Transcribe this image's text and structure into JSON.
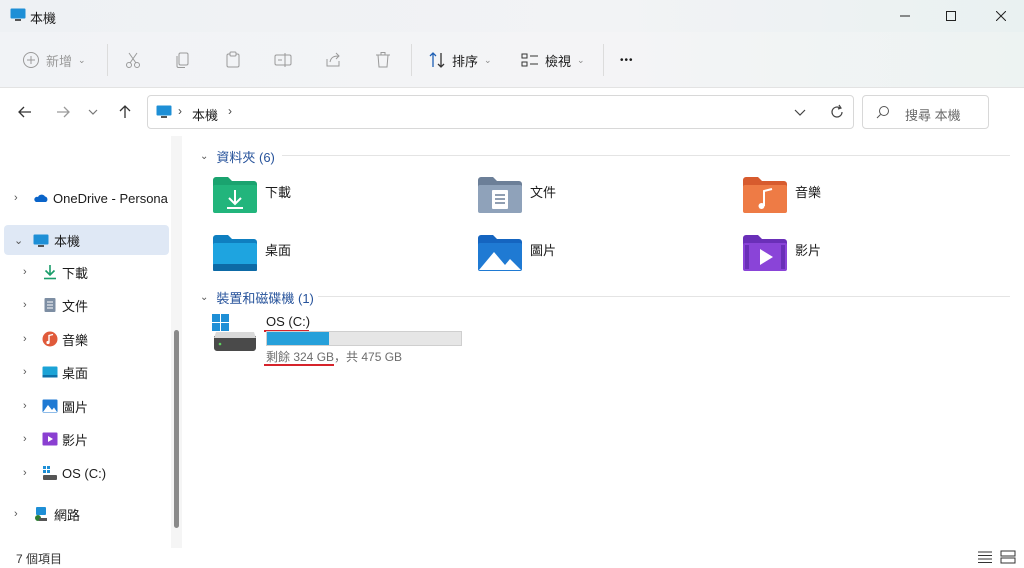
{
  "window": {
    "title": "本機"
  },
  "toolbar": {
    "new_label": "新增",
    "sort_label": "排序",
    "view_label": "檢視",
    "more_label": "•••"
  },
  "address": {
    "path_label": "本機"
  },
  "search": {
    "placeholder": "搜尋 本機"
  },
  "sidebar": {
    "items": [
      {
        "label": "OneDrive - Persona",
        "icon": "onedrive-icon"
      },
      {
        "label": "本機",
        "icon": "this-pc-icon"
      },
      {
        "label": "下載",
        "icon": "downloads-icon"
      },
      {
        "label": "文件",
        "icon": "documents-icon"
      },
      {
        "label": "音樂",
        "icon": "music-icon"
      },
      {
        "label": "桌面",
        "icon": "desktop-icon"
      },
      {
        "label": "圖片",
        "icon": "pictures-icon"
      },
      {
        "label": "影片",
        "icon": "videos-icon"
      },
      {
        "label": "OS (C:)",
        "icon": "drive-icon"
      },
      {
        "label": "網路",
        "icon": "network-icon"
      }
    ]
  },
  "content": {
    "folders_header": "資料夾 (6)",
    "folders": [
      {
        "label": "下載",
        "icon": "downloads-folder-icon"
      },
      {
        "label": "文件",
        "icon": "documents-folder-icon"
      },
      {
        "label": "音樂",
        "icon": "music-folder-icon"
      },
      {
        "label": "桌面",
        "icon": "desktop-folder-icon"
      },
      {
        "label": "圖片",
        "icon": "pictures-folder-icon"
      },
      {
        "label": "影片",
        "icon": "videos-folder-icon"
      }
    ],
    "devices_header": "裝置和磁碟機 (1)",
    "drive": {
      "name": "OS (C:)",
      "free_text": "剩餘 324 GB",
      "total_text": "，共 475 GB",
      "used_fraction": 0.32
    }
  },
  "status": {
    "item_count": "7 個項目"
  },
  "colors": {
    "accent": "#26a0da",
    "selection": "#dfe8f5",
    "header_blue": "#27539b",
    "annotation_red": "#d6232b"
  }
}
